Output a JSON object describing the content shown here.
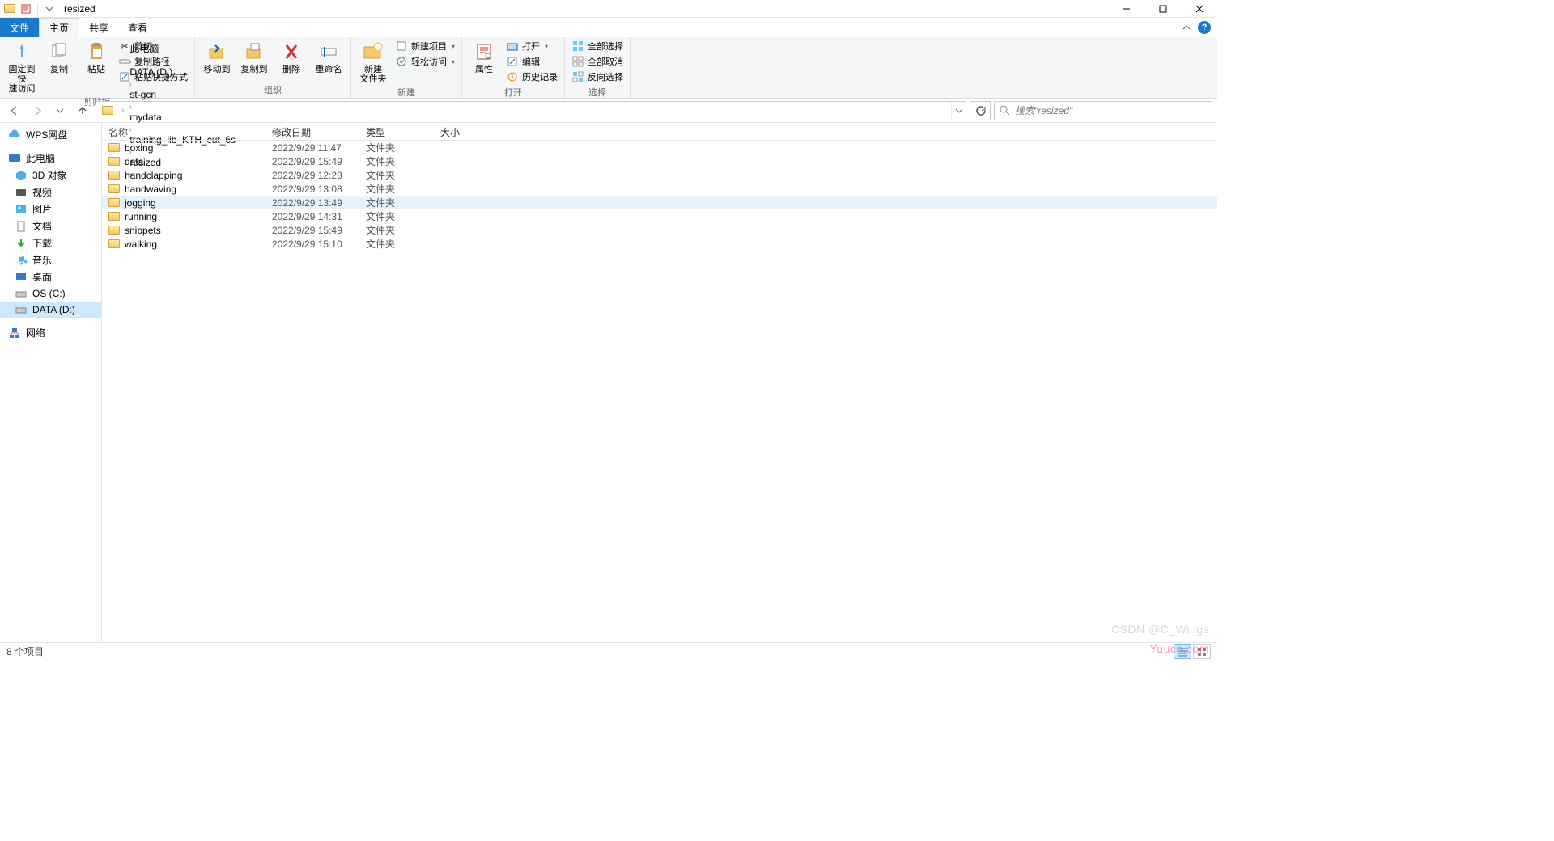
{
  "title": "resized",
  "tabs": {
    "file": "文件",
    "home": "主页",
    "share": "共享",
    "view": "查看"
  },
  "ribbon": {
    "clipboard": {
      "pin": "固定到快\n速访问",
      "copy": "复制",
      "paste": "粘贴",
      "cut": "剪切",
      "copy_path": "复制路径",
      "paste_shortcut": "粘贴快捷方式",
      "label": "剪贴板"
    },
    "organize": {
      "move_to": "移动到",
      "copy_to": "复制到",
      "delete": "删除",
      "rename": "重命名",
      "label": "组织"
    },
    "new": {
      "new_folder": "新建\n文件夹",
      "new_item": "新建项目",
      "easy_access": "轻松访问",
      "label": "新建"
    },
    "open": {
      "properties": "属性",
      "open": "打开",
      "edit": "编辑",
      "history": "历史记录",
      "label": "打开"
    },
    "select": {
      "select_all": "全部选择",
      "select_none": "全部取消",
      "invert": "反向选择",
      "label": "选择"
    }
  },
  "breadcrumbs": [
    "此电脑",
    "DATA (D:)",
    "st-gcn",
    "mydata",
    "training_lib_KTH_cut_6s",
    "resized"
  ],
  "search_placeholder": "搜索\"resized\"",
  "nav": {
    "wps": "WPS网盘",
    "this_pc": "此电脑",
    "objects_3d": "3D 对象",
    "videos": "视频",
    "pictures": "图片",
    "documents": "文档",
    "downloads": "下载",
    "music": "音乐",
    "desktop": "桌面",
    "os_c": "OS (C:)",
    "data_d": "DATA (D:)",
    "network": "网络"
  },
  "columns": {
    "name": "名称",
    "date": "修改日期",
    "type": "类型",
    "size": "大小"
  },
  "files": [
    {
      "name": "boxing",
      "date": "2022/9/29 11:47",
      "type": "文件夹",
      "size": ""
    },
    {
      "name": "data",
      "date": "2022/9/29 15:49",
      "type": "文件夹",
      "size": ""
    },
    {
      "name": "handclapping",
      "date": "2022/9/29 12:28",
      "type": "文件夹",
      "size": ""
    },
    {
      "name": "handwaving",
      "date": "2022/9/29 13:08",
      "type": "文件夹",
      "size": ""
    },
    {
      "name": "jogging",
      "date": "2022/9/29 13:49",
      "type": "文件夹",
      "size": "",
      "hover": true
    },
    {
      "name": "running",
      "date": "2022/9/29 14:31",
      "type": "文件夹",
      "size": ""
    },
    {
      "name": "snippets",
      "date": "2022/9/29 15:49",
      "type": "文件夹",
      "size": ""
    },
    {
      "name": "walking",
      "date": "2022/9/29 15:10",
      "type": "文件夹",
      "size": ""
    }
  ],
  "status": "8 个项目",
  "watermark1": "CSDN @C_Wings",
  "watermark2": "Yuucn.com"
}
